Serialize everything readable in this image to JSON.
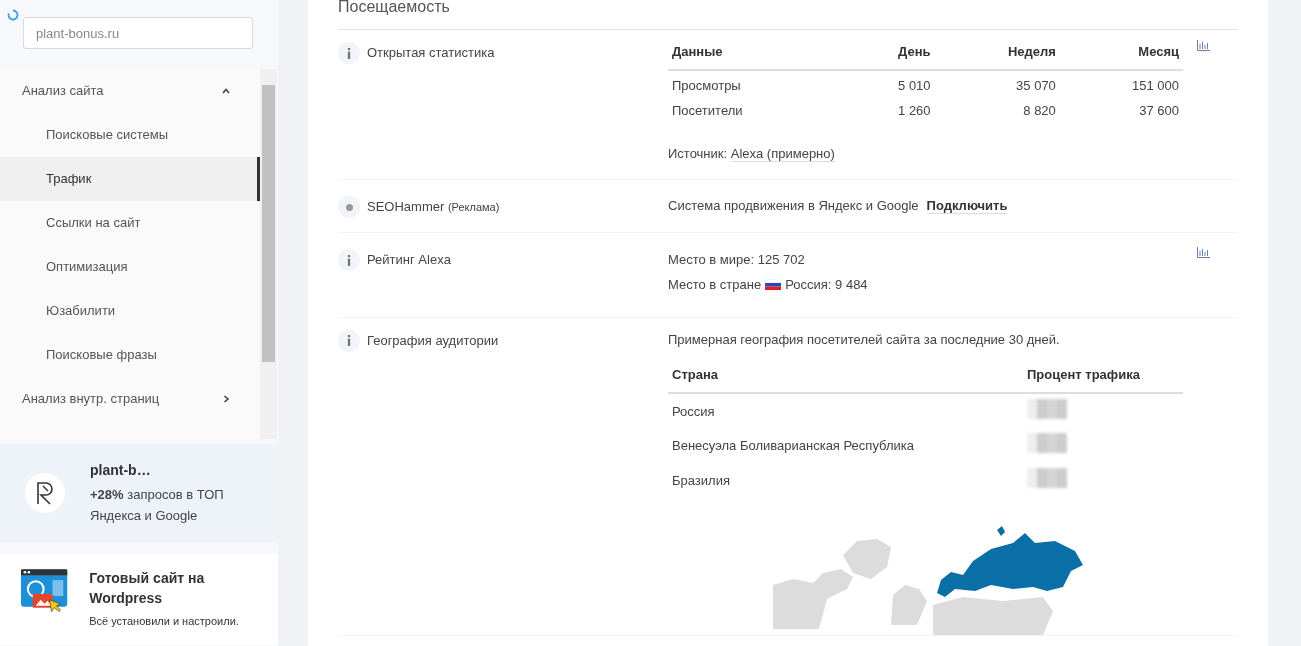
{
  "sidebar": {
    "search": {
      "value": "plant-bonus.ru"
    },
    "nav": [
      {
        "label": "Анализ сайта",
        "selected": false,
        "expanded": true,
        "children": [
          {
            "label": "Поисковые системы",
            "selected": false
          },
          {
            "label": "Трафик",
            "selected": true
          },
          {
            "label": "Ссылки на сайт",
            "selected": false
          },
          {
            "label": "Оптимизация",
            "selected": false
          },
          {
            "label": "Юзабилити",
            "selected": false
          },
          {
            "label": "Поисковые фразы",
            "selected": false
          }
        ]
      },
      {
        "label": "Анализ внутр. страниц",
        "selected": false,
        "expanded": false
      }
    ],
    "promo": {
      "title": "plant-b…",
      "text": "**+28%** запросов в ТОП Яндекса и Google"
    },
    "ad": {
      "title": "Готовый сайт на Wordpress",
      "text": "Всё установили и настроили."
    }
  },
  "section": {
    "title": "Посещаемость",
    "rows": [
      {
        "kind": "stats",
        "label": "Открытая статистика",
        "chart_button": true,
        "table": {
          "columns": [
            "Данные",
            "День",
            "Неделя",
            "Месяц"
          ],
          "rows": [
            [
              "Просмотры",
              "5 010",
              "35 070",
              "151 000"
            ],
            [
              "Посетители",
              "1 260",
              "8 820",
              "37 600"
            ]
          ]
        },
        "source_label": "Источник:",
        "source_link": "Alexa (примерно)"
      },
      {
        "kind": "ad",
        "label": "SEOHammer",
        "note": "(Реклама)",
        "chart_button": false,
        "text": "Система продвижения в Яндекс и Google",
        "link": "Подключить"
      },
      {
        "kind": "rating",
        "label": "Рейтинг Alexa",
        "chart_button": true,
        "world": "Место в мире: 125 702",
        "country_prefix": "Место в стране",
        "country": "Россия: 9 484"
      },
      {
        "kind": "geo",
        "label": "География аудитории",
        "chart_button": false,
        "intro": "Примерная география посетителей сайта за последние 30 дней.",
        "table": {
          "columns": [
            "Страна",
            "Процент трафика"
          ],
          "rows": [
            [
              "Россия"
            ],
            [
              "Венесуэла Боливарианская Республика"
            ],
            [
              "Бразилия"
            ]
          ]
        }
      }
    ]
  }
}
